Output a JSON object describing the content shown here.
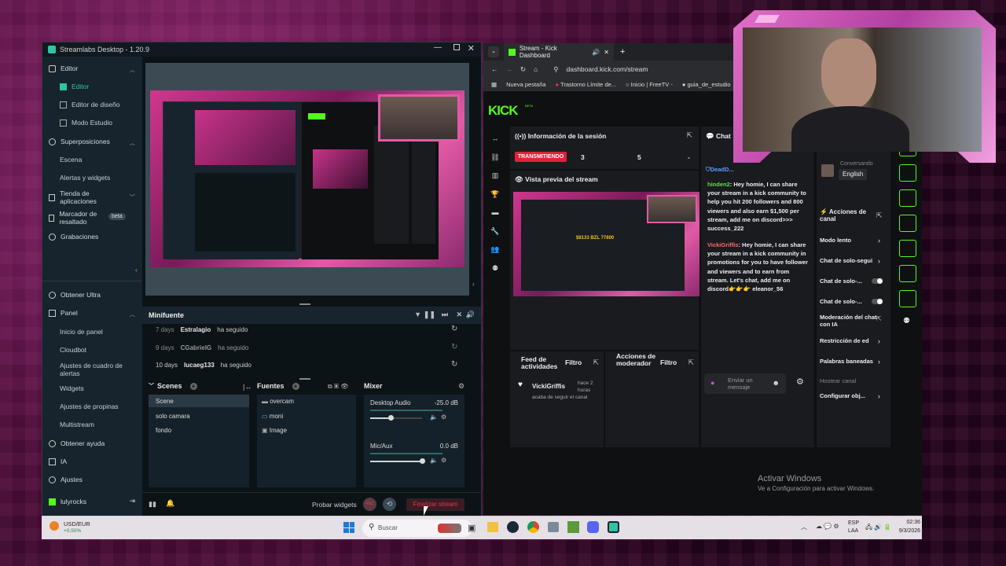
{
  "streamlabs": {
    "title": "Streamlabs Desktop - 1.20.9",
    "nav": {
      "editor": "Editor",
      "editor_sub": "Editor",
      "layout_editor": "Editor de diseño",
      "studio_mode": "Modo Estudio",
      "overlays": "Superposiciones",
      "scene": "Escena",
      "alerts": "Alertas y widgets",
      "app_store": "Tienda de aplicaciones",
      "highlighter": "Marcador de resaltado",
      "beta": "beta",
      "recordings": "Grabaciones",
      "get_ultra": "Obtener Ultra",
      "panel": "Panel",
      "panel_home": "Inicio de panel",
      "cloudbot": "Cloudbot",
      "alertbox": "Ajustes de cuadro de alertas",
      "widgets": "Widgets",
      "tips": "Ajustes de propinas",
      "multistream": "Multistream",
      "help": "Obtener ayuda",
      "ai": "IA",
      "settings": "Ajustes",
      "user": "lulyrocks"
    },
    "minifeed": {
      "title": "Minifuente",
      "rows": [
        {
          "time": "7 days",
          "name": "Estralagio",
          "action": "ha seguido"
        },
        {
          "time": "9 days",
          "name": "CGabrielG",
          "action": "ha seguido"
        },
        {
          "time": "10 days",
          "name": "lucaeg133",
          "action": "ha seguido"
        }
      ]
    },
    "scenes": {
      "title": "Scenes",
      "items": [
        "Scene",
        "solo camara",
        "fondo"
      ]
    },
    "sources": {
      "title": "Fuentes",
      "items": [
        "overcam",
        "moni",
        "Image"
      ]
    },
    "mixer": {
      "title": "Mixer",
      "channels": [
        {
          "name": "Desktop Audio",
          "db": "-25.0 dB",
          "level": 0.4
        },
        {
          "name": "Mic/Aux",
          "db": "0.0 dB",
          "level": 1.0
        }
      ]
    },
    "bottom": {
      "test_widgets": "Probar widgets",
      "rec": "REC",
      "end_stream": "Finalizar stream"
    }
  },
  "browser": {
    "tab_title": "Stream - Kick Dashboard",
    "url": "dashboard.kick.com/stream",
    "bookmarks": [
      "Nueva pestaña",
      "Trastorno Límite de...",
      "Inicio | FreeTV -",
      "guia_de_estudio"
    ],
    "kick": {
      "logo": "KICK",
      "beta": "BETA",
      "session_title": "Información de la sesión",
      "live": "TRANSMITIENDO",
      "stat1": "3",
      "stat2": "5",
      "stat3": "-",
      "preview_title": "Vista previa del stream",
      "preview_amount": "$8133 BZL 77800",
      "feed_title": "Feed de actividades",
      "filter": "Filtro",
      "feed_user": "VickiGriffis",
      "feed_time": "hace 2 horas",
      "feed_action": "acaba de seguir el canal",
      "mod_title": "Acciones de moderador",
      "filter2": "Filtro",
      "chat_title": "Chat",
      "chat": [
        {
          "user": "DeadD...",
          "text": ""
        },
        {
          "user": "hinden2",
          "text": ": Hey homie, I can share your stream in a kick community to help you hit 200 followers and 800 viewers and also earn $1,500 per stream, add me on discord>>> success_222"
        },
        {
          "user": "VickiGriffis",
          "text": ": Hey homie, I can share your stream in a kick community in promotions for you to have follower and viewers and to earn from stream. Let's chat, add me on discord👉👉👉 eleanor_56"
        }
      ],
      "chat_placeholder": "Enviar un mensaje",
      "lang_label": "Conversando",
      "lang": "English",
      "channel_actions": "Acciones de canal",
      "actions": [
        "Modo lento",
        "Chat de solo-segui",
        "Chat de solo-...",
        "Chat de solo-...",
        "Moderación del chat con IA",
        "Restricción de ed",
        "Palabras baneadas",
        "Hostear canal",
        "Configurar obj..."
      ]
    }
  },
  "windows_activation": {
    "title": "Activar Windows",
    "subtitle": "Ve a Configuración para activar Windows."
  },
  "taskbar": {
    "ticker": "USD/EUR",
    "ticker_change": "+0,50%",
    "search": "Buscar",
    "lang1": "ESP",
    "lang2": "LAA",
    "time": "02:36",
    "date": "9/3/2026"
  },
  "colors": {
    "streamlabs_accent": "#31c3a2",
    "kick_green": "#53fc18",
    "live_red": "#e0223a",
    "end_stream_red": "#e03a4a"
  }
}
